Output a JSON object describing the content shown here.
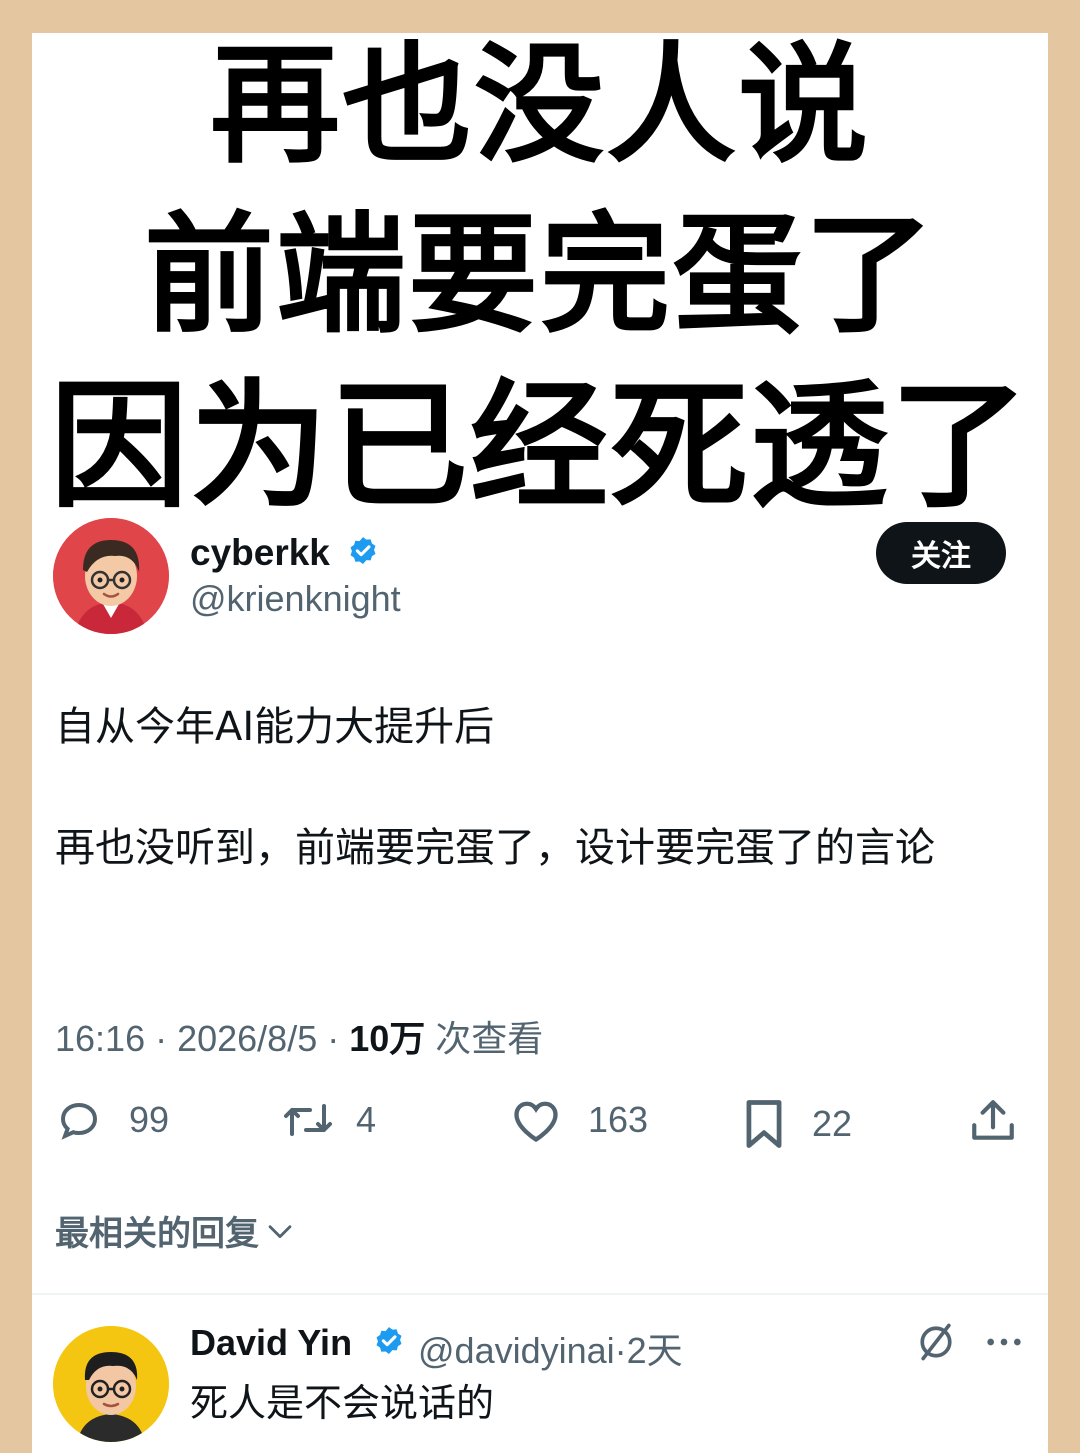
{
  "headline": {
    "line1": "再也没人说",
    "line2": "前端要完蛋了",
    "line3": "因为已经死透了"
  },
  "post": {
    "author_name": "cyberkk",
    "author_handle": "@krienknight",
    "follow_label": "关注",
    "text_line1": "自从今年AI能力大提升后",
    "text_line2": "再也没听到，前端要完蛋了，设计要完蛋了的言论",
    "time": "16:16 · 2026/8/5 · ",
    "views": "10万",
    "views_label": " 次查看",
    "actions": {
      "replies": "99",
      "reposts": "4",
      "likes": "163",
      "bookmarks": "22"
    }
  },
  "replies_sort_label": "最相关的回复",
  "reply": {
    "author_name": "David Yin",
    "author_handle": "@davidyinai",
    "time": "·2天",
    "text": "死人是不会说话的"
  },
  "colors": {
    "background": "#e4c6a0",
    "verified": "#1d9bf0",
    "text_primary": "#0f1419",
    "text_secondary": "#536471"
  }
}
